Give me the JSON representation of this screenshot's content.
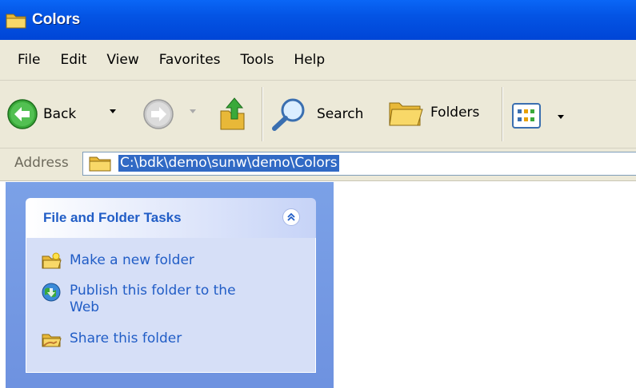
{
  "window": {
    "title": "Colors"
  },
  "menu": [
    "File",
    "Edit",
    "View",
    "Favorites",
    "Tools",
    "Help"
  ],
  "toolbar": {
    "back_label": "Back",
    "search_label": "Search",
    "folders_label": "Folders"
  },
  "address": {
    "label": "Address",
    "value": "C:\\bdk\\demo\\sunw\\demo\\Colors"
  },
  "task_pane": {
    "header": "File and Folder Tasks",
    "items": [
      {
        "label": "Make a new folder",
        "icon": "new-folder-icon"
      },
      {
        "label": "Publish this folder to the Web",
        "icon": "publish-web-icon"
      },
      {
        "label": "Share this folder",
        "icon": "share-folder-icon"
      }
    ]
  },
  "colors": {
    "title_bar": "#0454e4",
    "chrome": "#ece9d8",
    "task_pane_bg": "#7ba1e7",
    "task_body": "#d6dff7",
    "link": "#215dc6",
    "selection": "#316ac5"
  }
}
